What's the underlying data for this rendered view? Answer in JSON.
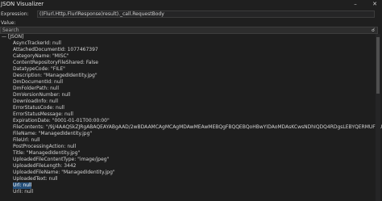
{
  "window": {
    "title": "JSON Visualizer"
  },
  "expression": {
    "label": "Expression:",
    "value": "((Flurl.Http.FlurlResponse)result)._call.RequestBody"
  },
  "value_label": "Value:",
  "search": {
    "placeholder": "Search"
  },
  "tree": {
    "root": "[JSON]",
    "items": [
      "AsyncTrackerId: null",
      "AttachedDocumentId: 1077467397",
      "CategoryName: \"MISC\"",
      "ContentRepositoryFileShared: False",
      "DatatypeCode: \"FILE\"",
      "Description: \"ManagedIdentity.jpg\"",
      "DmDocumentId: null",
      "DmFolderPath: null",
      "DmVersionNumber: null",
      "DownloadInfo: null",
      "ErrorStatusCode: null",
      "ErrorStatusMessage: null",
      "ExpirationDate: \"0001-01-01T00:00:00\"",
      "FileContents: \"/9j/4AAQSkZJRgABAQEAYABgAAD/2wBDAAMCAgMCAgMDAwMEAwMEBQgFBQQEBQoHBwYIDAoMDAsKCwsNDhIQDQ4RDgsLEBYQERMUFRUVDA8XGBYUGBIUFRT",
      "FileName: \"ManagedIdentity.jpg\"",
      "FileUrl: null",
      "PostProcessingAction: null",
      "Title: \"ManagedIdentity.jpg\"",
      "UploadedFileContentType: \"image/jpeg\"",
      "UploadedFileLength: 3442",
      "UploadedFileName: \"ManagedIdentity.jpg\"",
      "UploadedText: null",
      "Url: null",
      "UrlI: null"
    ],
    "selected_index": 22
  }
}
